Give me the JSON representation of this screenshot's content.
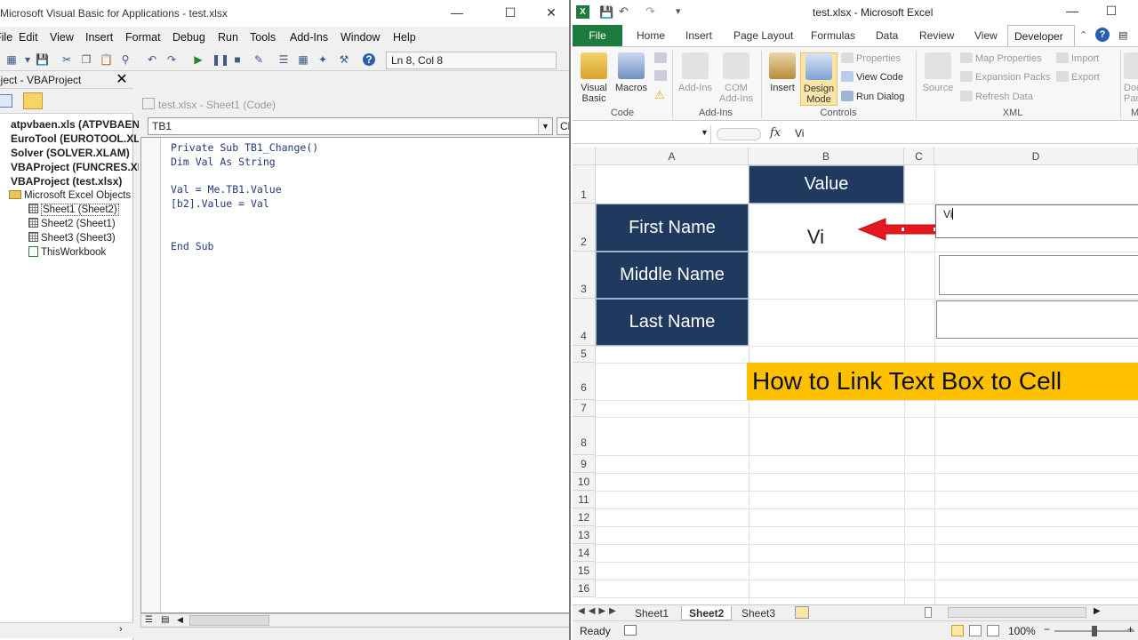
{
  "vba": {
    "title": "Microsoft Visual Basic for Applications - test.xlsx",
    "menu": [
      "File",
      "Edit",
      "View",
      "Insert",
      "Format",
      "Debug",
      "Run",
      "Tools",
      "Add-Ins",
      "Window",
      "Help"
    ],
    "position": "Ln 8, Col 8",
    "project_title": "Project - VBAProject",
    "tree": [
      "atpvbaen.xls (ATPVBAEN.XLAM)",
      "EuroTool (EUROTOOL.XLAM)",
      "Solver (SOLVER.XLAM)",
      "VBAProject (FUNCRES.XLAM)",
      "VBAProject (test.xlsx)",
      "Microsoft Excel Objects",
      "Sheet1 (Sheet2)",
      "Sheet2 (Sheet1)",
      "Sheet3 (Sheet3)",
      "ThisWorkbook"
    ],
    "code_title": "test.xlsx - Sheet1 (Code)",
    "object_combo": "TB1",
    "proc_combo": "Change",
    "code": "Private Sub TB1_Change()\nDim Val As String\n\nVal = Me.TB1.Value\n[b2].Value = Val\n\n\nEnd Sub"
  },
  "excel": {
    "title": "test.xlsx - Microsoft Excel",
    "file_tab": "File",
    "tabs": [
      "Home",
      "Insert",
      "Page Layout",
      "Formulas",
      "Data",
      "Review",
      "View",
      "Developer"
    ],
    "ribbon": {
      "visual_basic": "Visual Basic",
      "macros": "Macros",
      "addins": "Add-Ins",
      "com_addins": "COM Add-Ins",
      "insert": "Insert",
      "design_mode": "Design Mode",
      "properties": "Properties",
      "view_code": "View Code",
      "run_dialog": "Run Dialog",
      "source": "Source",
      "map_properties": "Map Properties",
      "expansion_packs": "Expansion Packs",
      "refresh_data": "Refresh Data",
      "import": "Import",
      "export": "Export",
      "document_panel": "Document Panel",
      "groups": [
        "Code",
        "Add-Ins",
        "Controls",
        "XML",
        "Modify"
      ]
    },
    "formula_value": "Vi",
    "columns": [
      "A",
      "B",
      "C",
      "D"
    ],
    "rows": [
      "1",
      "2",
      "3",
      "4",
      "5",
      "6",
      "7",
      "8",
      "9",
      "10",
      "11",
      "12",
      "13",
      "14",
      "15",
      "16"
    ],
    "cells": {
      "b1": "Value",
      "a2": "First Name",
      "a3": "Middle Name",
      "a4": "Last Name",
      "b2": "Vi",
      "banner": "How to Link Text Box to Cell"
    },
    "textbox_value": "Vi",
    "sheets": [
      "Sheet1",
      "Sheet2",
      "Sheet3"
    ],
    "status": "Ready",
    "zoom": "100%"
  }
}
